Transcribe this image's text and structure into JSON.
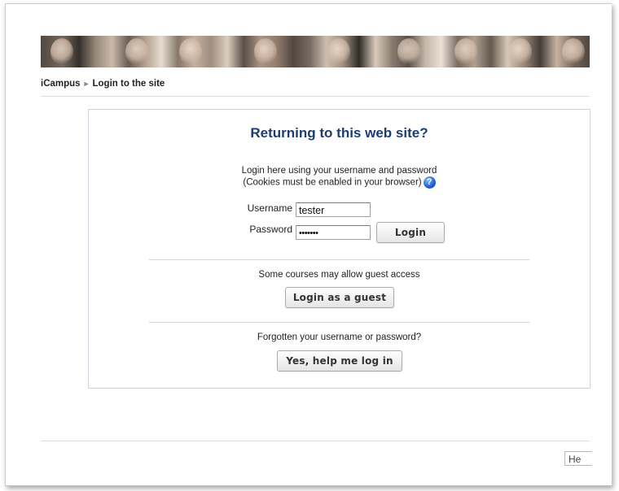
{
  "breadcrumb": {
    "site": "iCampus",
    "current": "Login to the site"
  },
  "login": {
    "heading": "Returning to this web site?",
    "description_line1": "Login here using your username and password",
    "description_line2": "(Cookies must be enabled in your browser)",
    "username_label": "Username",
    "username_value": "tester",
    "password_label": "Password",
    "password_value": "•••••••",
    "login_button": "Login"
  },
  "guest": {
    "note": "Some courses may allow guest access",
    "button": "Login as a guest"
  },
  "forgot": {
    "note": "Forgotten your username or password?",
    "button": "Yes, help me log in"
  },
  "footer": {
    "partial_button": "He"
  },
  "icons": {
    "help": "help-icon",
    "breadcrumb_separator": "breadcrumb-arrow-icon"
  },
  "colors": {
    "heading": "#1e3d6e",
    "help_icon": "#1f5fd1"
  }
}
